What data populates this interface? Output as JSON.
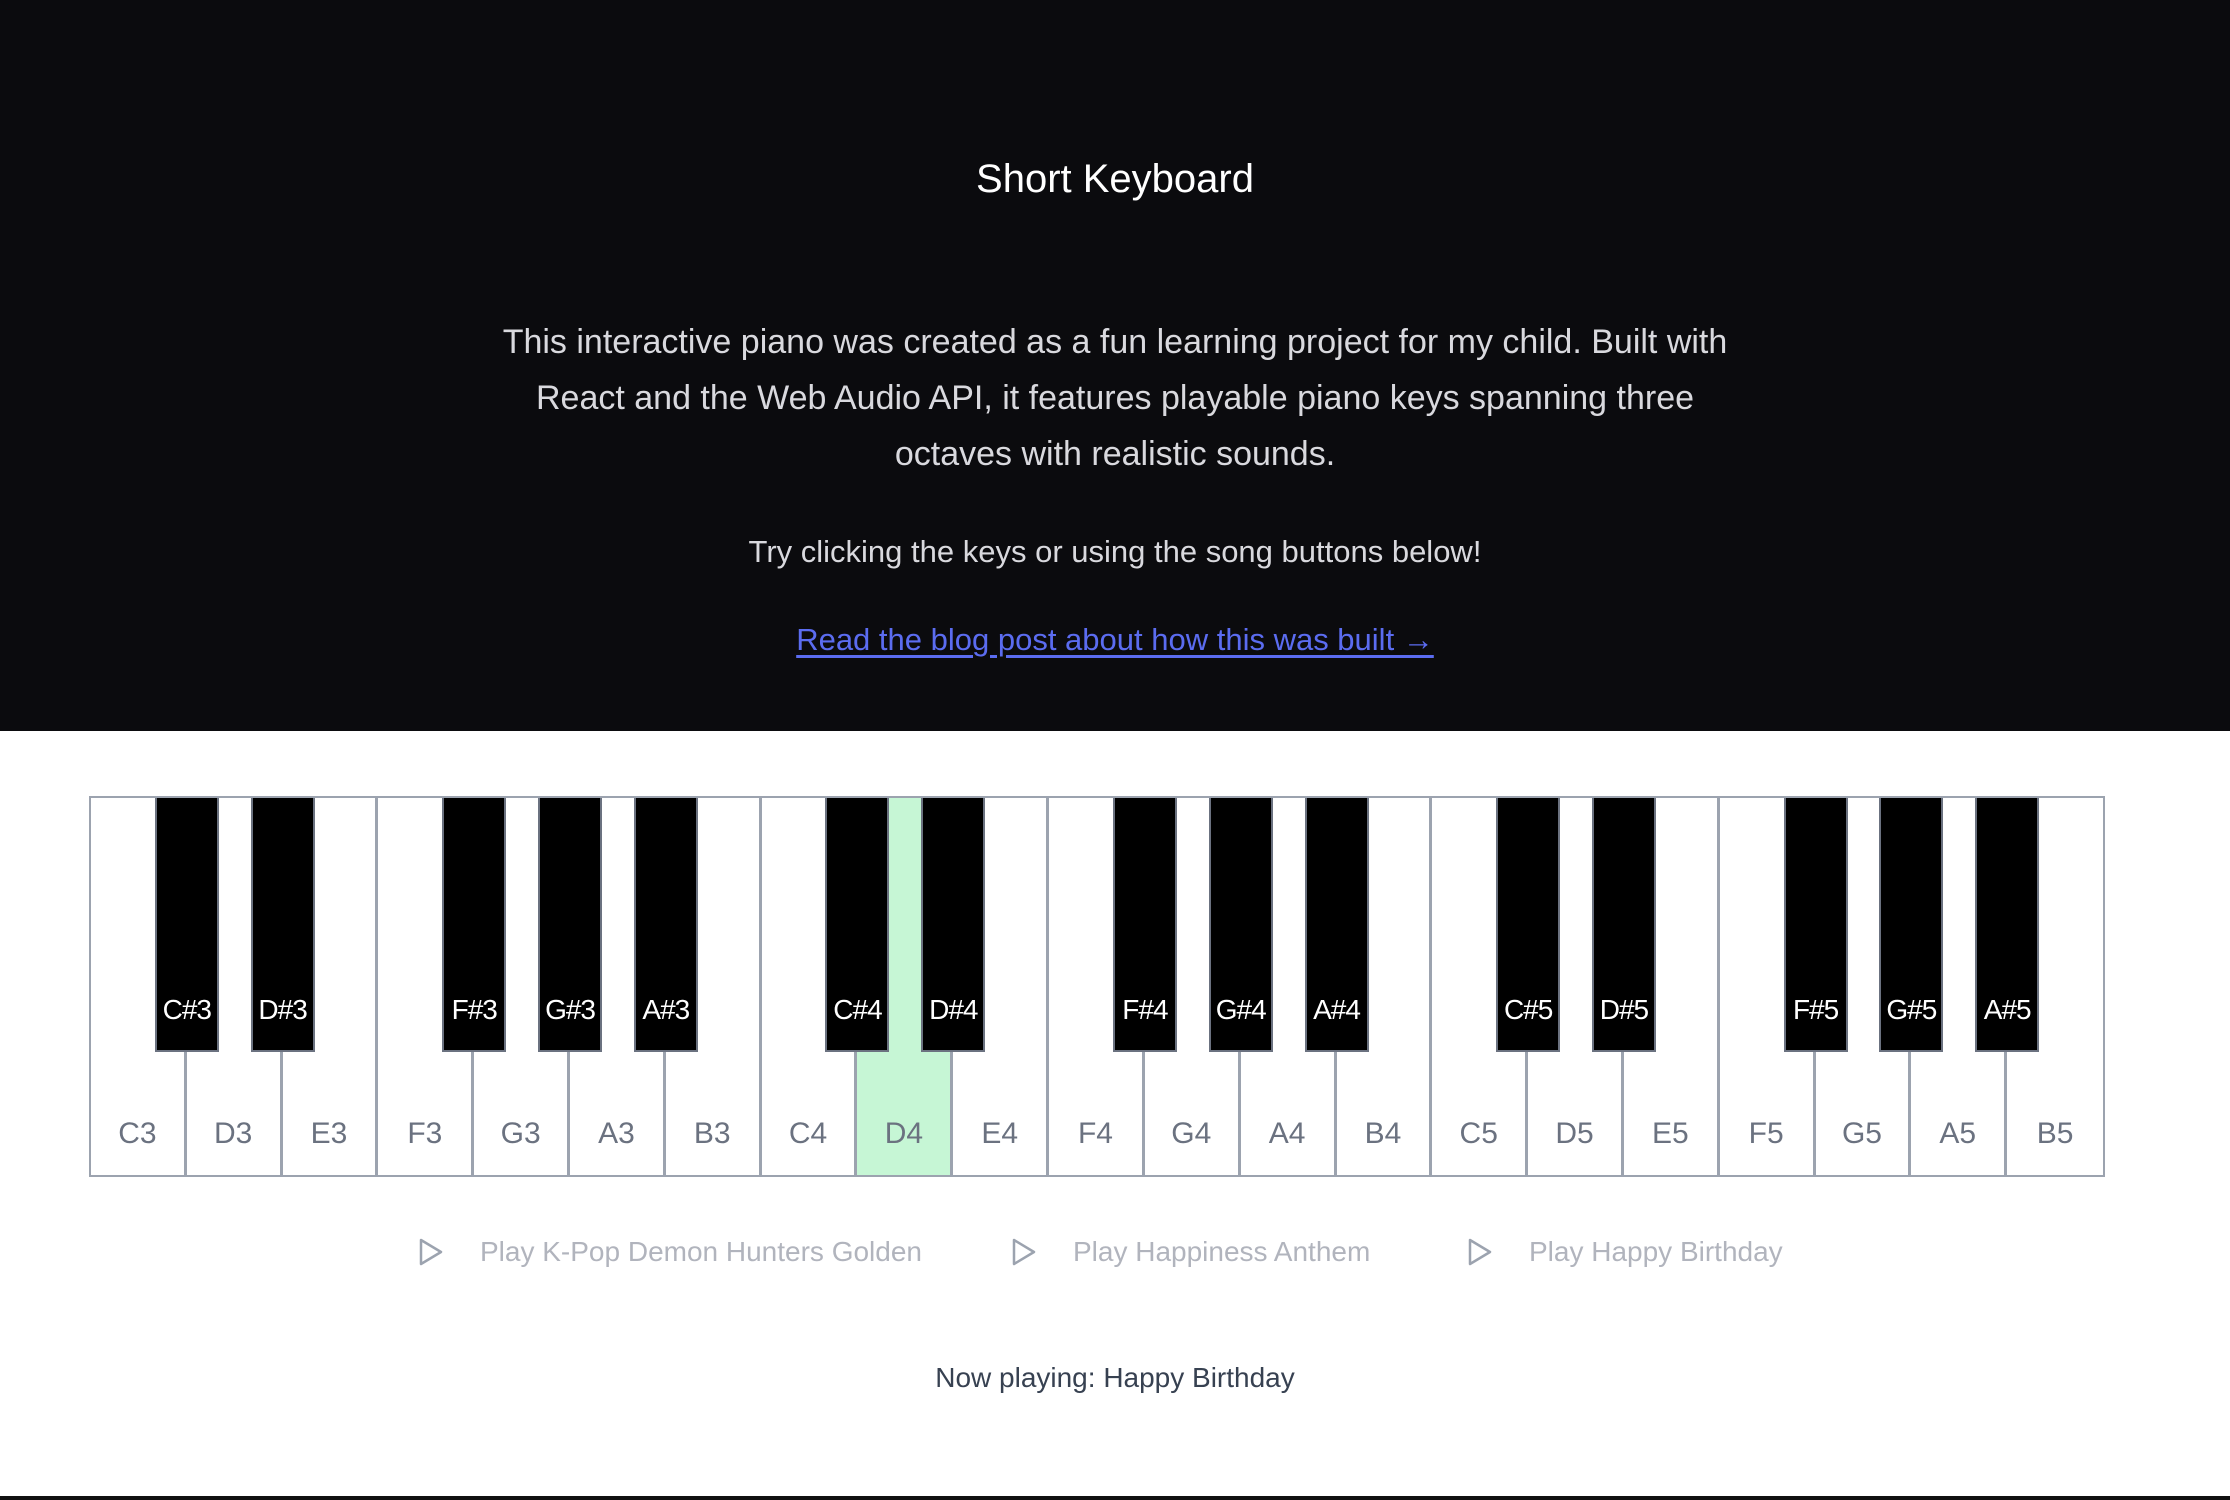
{
  "header": {
    "title": "Short Keyboard",
    "description": "This interactive piano was created as a fun learning project for my child. Built with React and the Web Audio API, it features playable piano keys spanning three octaves with realistic sounds.",
    "hint": "Try clicking the keys or using the song buttons below!",
    "blog_link": "Read the blog post about how this was built →"
  },
  "keyboard": {
    "white_keys": [
      "C3",
      "D3",
      "E3",
      "F3",
      "G3",
      "A3",
      "B3",
      "C4",
      "D4",
      "E4",
      "F4",
      "G4",
      "A4",
      "B4",
      "C5",
      "D5",
      "E5",
      "F5",
      "G5",
      "A5",
      "B5"
    ],
    "black_keys": [
      "C#3",
      "D#3",
      "F#3",
      "G#3",
      "A#3",
      "C#4",
      "D#4",
      "F#4",
      "G#4",
      "A#4",
      "C#5",
      "D#5",
      "F#5",
      "G#5",
      "A#5"
    ],
    "active_key": "D4",
    "active_color": "#c6f6d5"
  },
  "songs": [
    {
      "label": "Play K-Pop Demon Hunters Golden",
      "icon": "play-icon"
    },
    {
      "label": "Play Happiness Anthem",
      "icon": "play-icon"
    },
    {
      "label": "Play Happy Birthday",
      "icon": "play-icon"
    }
  ],
  "status": {
    "now_playing": "Now playing: Happy Birthday"
  }
}
